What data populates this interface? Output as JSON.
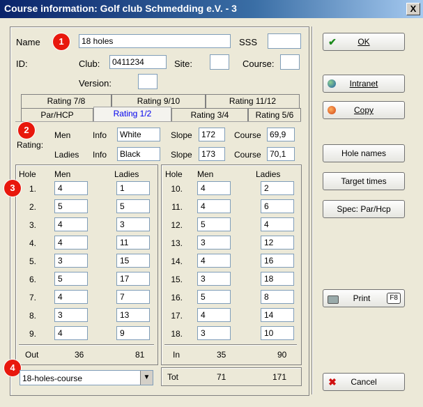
{
  "window": {
    "title": "Course information: Golf club Schmedding e.V. - 3",
    "close_glyph": "X"
  },
  "header": {
    "name_label": "Name",
    "name_value": "18 holes",
    "sss_label": "SSS",
    "sss_value": "",
    "id_label": "ID:",
    "club_label": "Club:",
    "club_value": "0411234",
    "site_label": "Site:",
    "site_value": "",
    "course_label": "Course:",
    "course_value": "",
    "version_label": "Version:",
    "version_value": ""
  },
  "badges": [
    "1",
    "2",
    "3",
    "4"
  ],
  "tabs": {
    "top_row": [
      "Rating 7/8",
      "Rating 9/10",
      "Rating 11/12"
    ],
    "bottom_row": [
      "Par/HCP",
      "Rating 1/2",
      "Rating 3/4",
      "Rating 5/6"
    ],
    "active": "Rating 1/2"
  },
  "rating": {
    "label": "Rating:",
    "men": {
      "label": "Men",
      "info_label": "Info",
      "info": "White",
      "slope_label": "Slope",
      "slope": "172",
      "course_label": "Course",
      "course": "69,9"
    },
    "ladies": {
      "label": "Ladies",
      "info_label": "Info",
      "info": "Black",
      "slope_label": "Slope",
      "slope": "173",
      "course_label": "Course",
      "course": "70,1"
    }
  },
  "holes_header": {
    "hole": "Hole",
    "men": "Men",
    "ladies": "Ladies"
  },
  "holes_left": [
    {
      "hole": "1.",
      "men": "4",
      "ladies": "1"
    },
    {
      "hole": "2.",
      "men": "5",
      "ladies": "5"
    },
    {
      "hole": "3.",
      "men": "4",
      "ladies": "3"
    },
    {
      "hole": "4.",
      "men": "4",
      "ladies": "11"
    },
    {
      "hole": "5.",
      "men": "3",
      "ladies": "15"
    },
    {
      "hole": "6.",
      "men": "5",
      "ladies": "17"
    },
    {
      "hole": "7.",
      "men": "4",
      "ladies": "7"
    },
    {
      "hole": "8.",
      "men": "3",
      "ladies": "13"
    },
    {
      "hole": "9.",
      "men": "4",
      "ladies": "9"
    }
  ],
  "holes_right": [
    {
      "hole": "10.",
      "men": "4",
      "ladies": "2"
    },
    {
      "hole": "11.",
      "men": "4",
      "ladies": "6"
    },
    {
      "hole": "12.",
      "men": "5",
      "ladies": "4"
    },
    {
      "hole": "13.",
      "men": "3",
      "ladies": "12"
    },
    {
      "hole": "14.",
      "men": "4",
      "ladies": "16"
    },
    {
      "hole": "15.",
      "men": "3",
      "ladies": "18"
    },
    {
      "hole": "16.",
      "men": "5",
      "ladies": "8"
    },
    {
      "hole": "17.",
      "men": "4",
      "ladies": "14"
    },
    {
      "hole": "18.",
      "men": "3",
      "ladies": "10"
    }
  ],
  "totals": {
    "out_label": "Out",
    "out_men": "36",
    "out_ladies": "81",
    "in_label": "In",
    "in_men": "35",
    "in_ladies": "90",
    "tot_label": "Tot",
    "tot_men": "71",
    "tot_ladies": "171"
  },
  "course_select": {
    "value": "18-holes-course"
  },
  "buttons": {
    "ok": "OK",
    "intranet": "Intranet",
    "copy": "Copy",
    "hole_names": "Hole names",
    "target_times": "Target times",
    "spec_par_hcp": "Spec: Par/Hcp",
    "print": "Print",
    "print_key": "F8",
    "cancel": "Cancel"
  },
  "colors": {
    "titlebar": "#0a246a",
    "badge": "#e8180d",
    "active_tab": "#0000ee"
  }
}
